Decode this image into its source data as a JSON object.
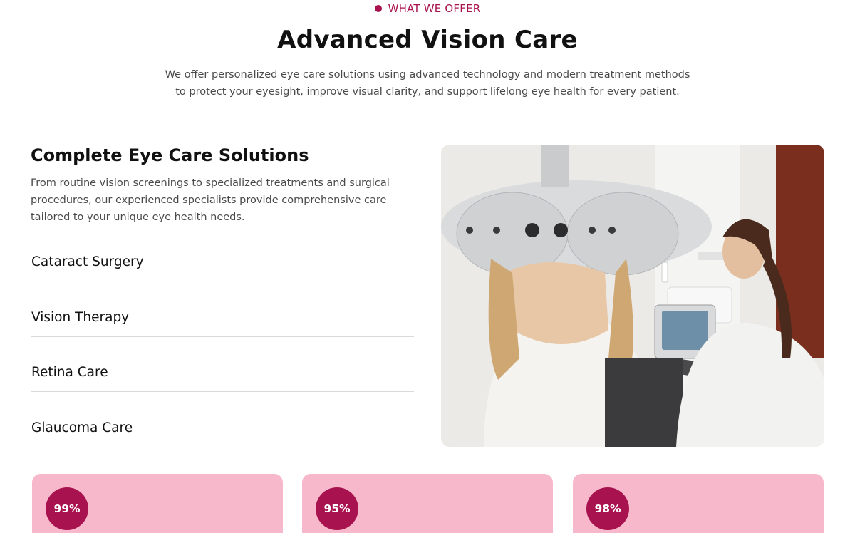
{
  "header": {
    "eyebrow": "WHAT WE OFFER",
    "title": "Advanced Vision Care",
    "intro": "We offer personalized eye care solutions using advanced technology and modern treatment methods to protect your eyesight, improve visual clarity, and support lifelong eye health for every patient."
  },
  "solutions": {
    "title": "Complete Eye Care Solutions",
    "description": "From routine vision screenings to specialized treatments and surgical procedures, our experienced specialists provide comprehensive care tailored to your unique eye health needs.",
    "items": [
      {
        "label": "Cataract Surgery"
      },
      {
        "label": "Vision Therapy"
      },
      {
        "label": "Retina Care"
      },
      {
        "label": "Glaucoma Care"
      }
    ]
  },
  "stats": [
    {
      "value": "99%"
    },
    {
      "value": "95%"
    },
    {
      "value": "98%"
    }
  ],
  "colors": {
    "accent": "#a8134f",
    "card_bg": "#f7b8cb"
  }
}
